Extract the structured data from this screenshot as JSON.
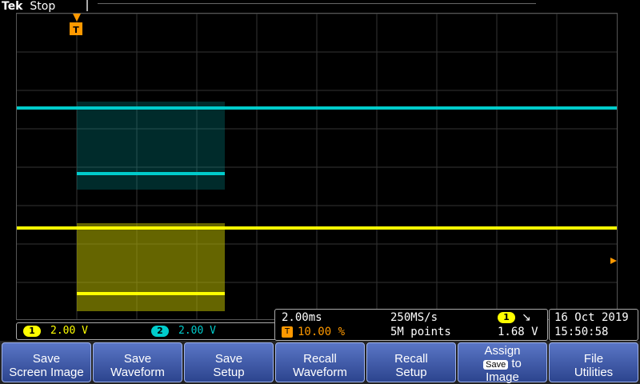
{
  "colors": {
    "ch1": "#ffff00",
    "ch2": "#00cccc",
    "trigger": "#ff9900",
    "menu": "#3f5db7"
  },
  "status": {
    "brand": "Tek",
    "state": "Stop"
  },
  "markers": {
    "ch1": "1",
    "ch2": "2",
    "trigger": "T"
  },
  "channels": {
    "ch1_scale": "2.00 V",
    "ch2_scale": "2.00 V"
  },
  "timebase": {
    "time_div": "2.00ms",
    "sample_rate": "250MS/s",
    "record_length": "5M points",
    "trigger_pos": "10.00 %",
    "trigger_level": "1.68 V"
  },
  "datetime": {
    "date": "16 Oct  2019",
    "time": "15:50:58"
  },
  "menu": {
    "save_screen": [
      "Save",
      "Screen Image"
    ],
    "save_waveform": [
      "Save",
      "Waveform"
    ],
    "save_setup": [
      "Save",
      "Setup"
    ],
    "recall_waveform": [
      "Recall",
      "Waveform"
    ],
    "recall_setup": [
      "Recall",
      "Setup"
    ],
    "assign": [
      "Assign",
      "Save",
      "to",
      "Image"
    ],
    "file_utilities": [
      "File",
      "Utilities"
    ]
  }
}
